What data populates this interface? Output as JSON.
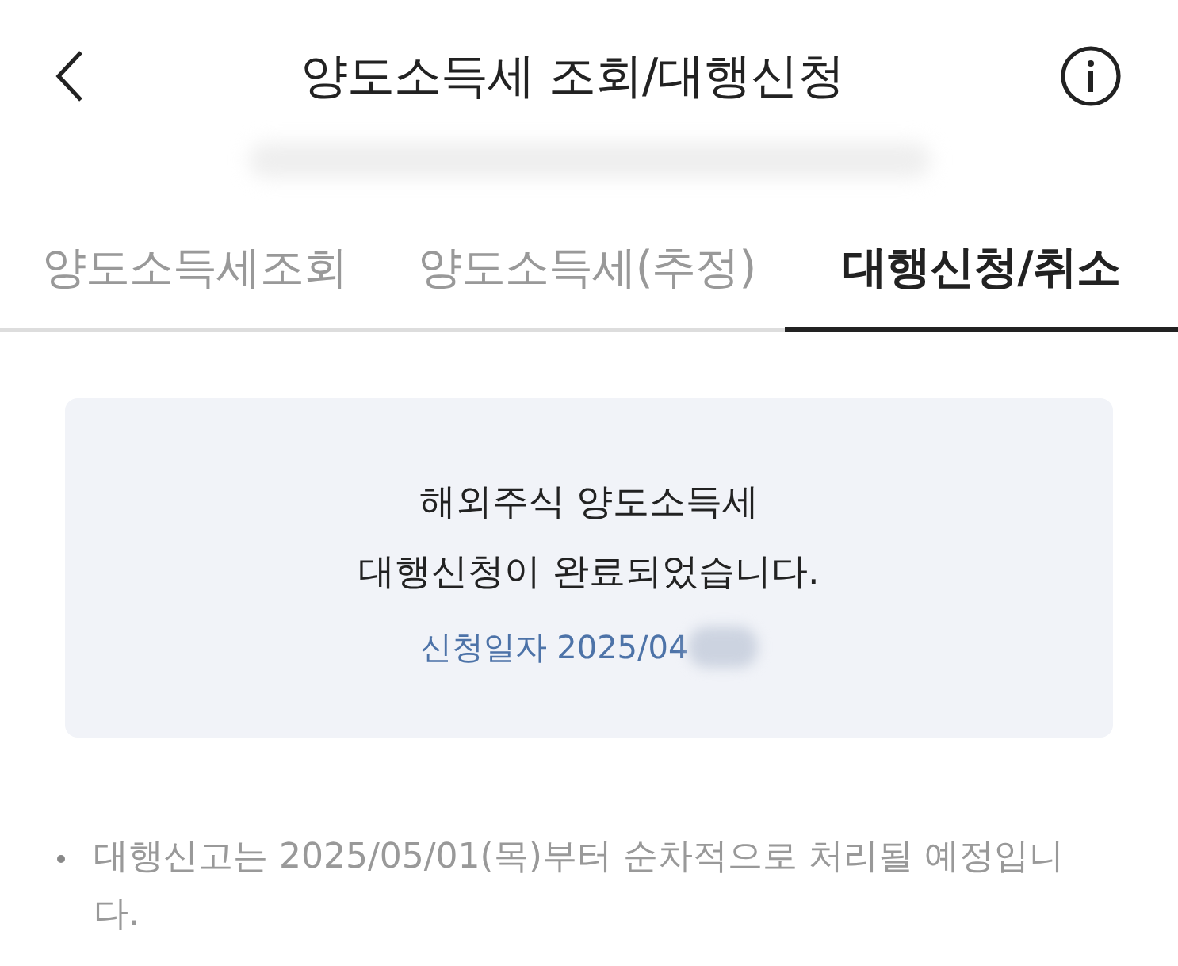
{
  "header": {
    "title": "양도소득세 조회/대행신청"
  },
  "tabs": [
    {
      "label": "양도소득세조회",
      "selected": false
    },
    {
      "label": "양도소득세(추정)",
      "selected": false
    },
    {
      "label": "대행신청/취소",
      "selected": true
    }
  ],
  "result_card": {
    "message_lines": [
      "해외주식 양도소득세",
      "대행신청이 완료되었습니다."
    ],
    "date": "신청일자 2025/04"
  },
  "notes": [
    "대행신고는 2025/05/01(목)부터 순차적으로 처리될 예정입니다."
  ]
}
